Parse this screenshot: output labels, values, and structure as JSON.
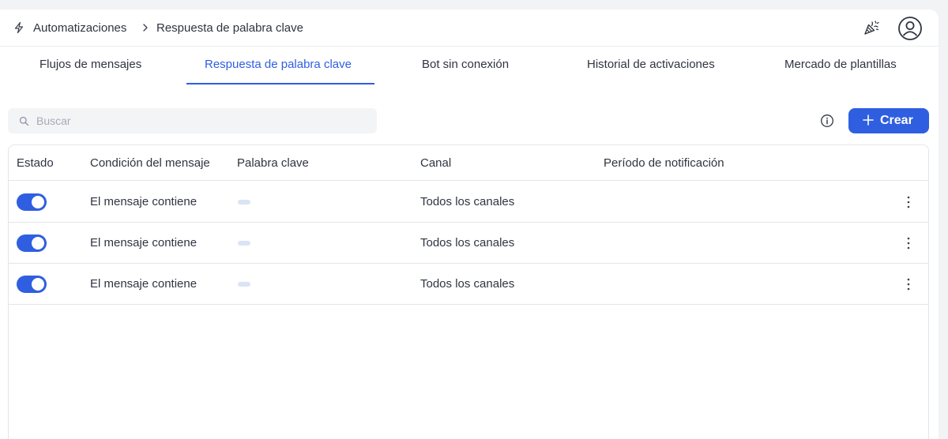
{
  "breadcrumb": {
    "root": "Automatizaciones",
    "current": "Respuesta de palabra clave"
  },
  "header_icons": [
    "bolt-icon",
    "chevron-right-icon",
    "party-popper-icon",
    "user-avatar-icon"
  ],
  "tabs": [
    {
      "label": "Flujos de mensajes",
      "active": false
    },
    {
      "label": "Respuesta de palabra clave",
      "active": true
    },
    {
      "label": "Bot sin conexión",
      "active": false
    },
    {
      "label": "Historial de activaciones",
      "active": false
    },
    {
      "label": "Mercado de plantillas",
      "active": false
    }
  ],
  "search": {
    "placeholder": "Buscar",
    "value": ""
  },
  "toolbar": {
    "create_label": "Crear",
    "info_icon": "info-icon"
  },
  "colors": {
    "accent": "#2f5fe0",
    "border": "#e3e5e9",
    "keyword_pill": "#dbe4f5"
  },
  "table": {
    "columns": [
      "Estado",
      "Condición del mensaje",
      "Palabra clave",
      "Canal",
      "Período de notificación"
    ],
    "rows": [
      {
        "enabled": true,
        "condition": "El mensaje contiene",
        "keyword": "",
        "channel": "Todos los canales",
        "period": ""
      },
      {
        "enabled": true,
        "condition": "El mensaje contiene",
        "keyword": "",
        "channel": "Todos los canales",
        "period": ""
      },
      {
        "enabled": true,
        "condition": "El mensaje contiene",
        "keyword": "",
        "channel": "Todos los canales",
        "period": ""
      }
    ]
  }
}
